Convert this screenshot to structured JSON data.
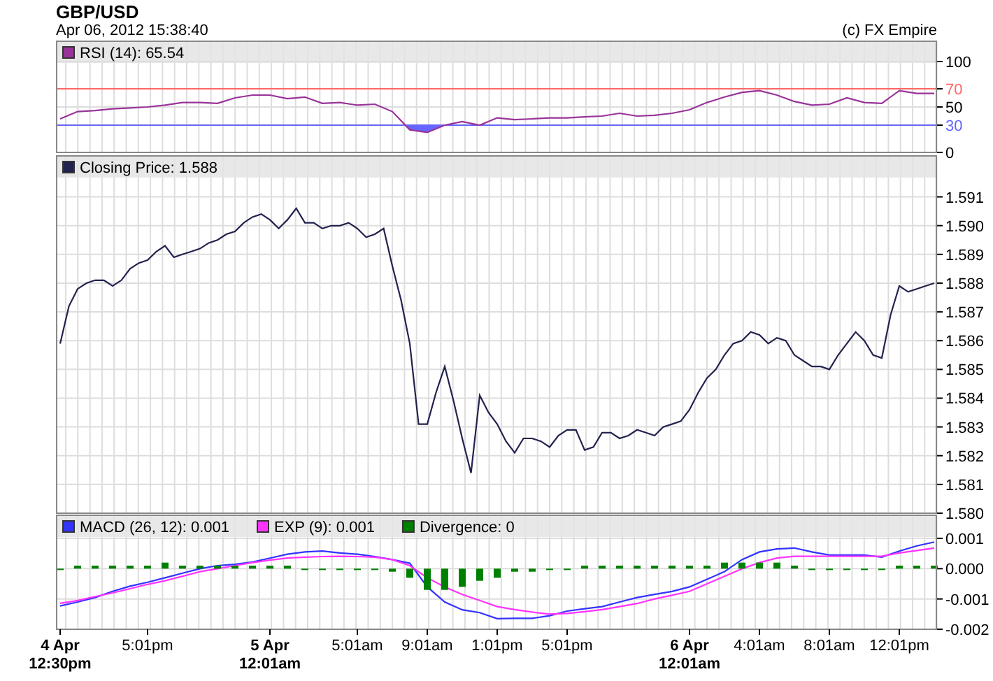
{
  "header": {
    "title": "GBP/USD",
    "timestamp": "Apr 06, 2012 15:38:40",
    "copyright": "(c) FX Empire"
  },
  "panels": [
    {
      "kind": "rsi",
      "chart_data": {
        "type": "line",
        "grid": true,
        "legend": true,
        "ylim": [
          0,
          100
        ],
        "yticks": [
          0,
          30,
          50,
          70,
          100
        ],
        "categories": [
          null,
          null,
          null,
          null,
          null,
          null,
          null,
          null,
          null,
          null,
          null,
          null,
          null,
          null,
          null,
          null,
          null,
          null,
          null,
          null,
          null,
          null,
          null,
          null,
          null,
          null,
          null,
          null,
          null,
          null,
          null,
          null,
          null,
          null,
          null,
          null,
          null,
          null,
          null,
          null,
          null,
          null,
          null,
          null,
          null,
          null,
          null,
          null,
          null,
          null,
          null
        ],
        "series": [
          {
            "name": "RSI (14): 65.54",
            "color": "#993399",
            "values": [
              37,
              45,
              46,
              48,
              49,
              50,
              52,
              55,
              55,
              54,
              60,
              63,
              63,
              59,
              61,
              54,
              55,
              52,
              53,
              45,
              25,
              22,
              30,
              34,
              30,
              38,
              36,
              37,
              38,
              38,
              39,
              40,
              43,
              40,
              41,
              43,
              47,
              55,
              61,
              66,
              68,
              63,
              56,
              52,
              53,
              60,
              55,
              54,
              68,
              65,
              65
            ]
          }
        ],
        "ref_lines": [
          {
            "axis": "y",
            "value": 70,
            "color": "#ff6666"
          },
          {
            "axis": "y",
            "value": 30,
            "color": "#6666ff"
          }
        ]
      }
    },
    {
      "kind": "price",
      "chart_data": {
        "type": "line",
        "grid": true,
        "legend": true,
        "ylim": [
          1.58,
          1.5924
        ],
        "yticks": [
          {
            "value": 1.58,
            "label": "1.580"
          },
          {
            "value": 1.581,
            "label": "1.581"
          },
          {
            "value": 1.582,
            "label": "1.582"
          },
          {
            "value": 1.583,
            "label": "1.583"
          },
          {
            "value": 1.584,
            "label": "1.584"
          },
          {
            "value": 1.585,
            "label": "1.585"
          },
          {
            "value": 1.586,
            "label": "1.586"
          },
          {
            "value": 1.587,
            "label": "1.587"
          },
          {
            "value": 1.588,
            "label": "1.588"
          },
          {
            "value": 1.589,
            "label": "1.589"
          },
          {
            "value": 1.59,
            "label": "1.590"
          },
          {
            "value": 1.591,
            "label": "1.591"
          }
        ],
        "categories": [
          null,
          null,
          null,
          null,
          null,
          null,
          null,
          null,
          null,
          null,
          null,
          null,
          null,
          null,
          null,
          null,
          null,
          null,
          null,
          null,
          null,
          null,
          null,
          null,
          null,
          null,
          null,
          null,
          null,
          null,
          null,
          null,
          null,
          null,
          null,
          null,
          null,
          null,
          null,
          null,
          null,
          null,
          null,
          null,
          null,
          null,
          null,
          null,
          null,
          null,
          null,
          null,
          null,
          null,
          null,
          null,
          null,
          null,
          null,
          null,
          null,
          null,
          null,
          null,
          null,
          null,
          null,
          null,
          null,
          null,
          null,
          null,
          null,
          null,
          null,
          null,
          null,
          null,
          null,
          null,
          null,
          null,
          null,
          null,
          null,
          null,
          null,
          null,
          null,
          null,
          null,
          null,
          null,
          null,
          null,
          null,
          null,
          null,
          null,
          null,
          null
        ],
        "series": [
          {
            "name": "Closing Price: 1.588",
            "color": "#22224f",
            "values": [
              1.5859,
              1.5872,
              1.5878,
              1.588,
              1.5881,
              1.5881,
              1.5879,
              1.5881,
              1.5885,
              1.5887,
              1.5888,
              1.5891,
              1.5893,
              1.5889,
              1.589,
              1.5891,
              1.5892,
              1.5894,
              1.5895,
              1.5897,
              1.5898,
              1.5901,
              1.5903,
              1.5904,
              1.5902,
              1.5899,
              1.5902,
              1.5906,
              1.5901,
              1.5901,
              1.5899,
              1.59,
              1.59,
              1.5901,
              1.5899,
              1.5896,
              1.5897,
              1.5899,
              1.5886,
              1.5874,
              1.5859,
              1.5831,
              1.5831,
              1.5842,
              1.5851,
              1.5839,
              1.5826,
              1.5814,
              1.5841,
              1.5835,
              1.5831,
              1.5825,
              1.5821,
              1.5826,
              1.5826,
              1.5825,
              1.5823,
              1.5827,
              1.5829,
              1.5829,
              1.5822,
              1.5823,
              1.5828,
              1.5828,
              1.5826,
              1.5827,
              1.5829,
              1.5828,
              1.5827,
              1.583,
              1.5831,
              1.5832,
              1.5836,
              1.5842,
              1.5847,
              1.585,
              1.5855,
              1.5859,
              1.586,
              1.5863,
              1.5862,
              1.5859,
              1.5861,
              1.586,
              1.5855,
              1.5853,
              1.5851,
              1.5851,
              1.585,
              1.5855,
              1.5859,
              1.5863,
              1.586,
              1.5855,
              1.5854,
              1.5869,
              1.5879,
              1.5877,
              1.5878,
              1.5879,
              1.588
            ]
          }
        ]
      }
    },
    {
      "kind": "macd",
      "chart_data": {
        "type": "line",
        "grid": true,
        "legend": true,
        "ylim": [
          -0.002,
          0.001
        ],
        "yticks": [
          {
            "value": -0.002,
            "label": "-0.002"
          },
          {
            "value": -0.001,
            "label": "-0.001"
          },
          {
            "value": 0,
            "label": "0.000"
          },
          {
            "value": 0.001,
            "label": "0.001"
          }
        ],
        "categories": [
          "4 Apr\n12:30pm",
          null,
          null,
          null,
          null,
          "5:01pm",
          null,
          null,
          null,
          null,
          null,
          null,
          "5 Apr\n12:01am",
          null,
          null,
          null,
          null,
          "5:01am",
          null,
          null,
          null,
          "9:01am",
          null,
          null,
          null,
          "1:01pm",
          null,
          null,
          null,
          "5:01pm",
          null,
          null,
          null,
          null,
          null,
          null,
          "6 Apr\n12:01am",
          null,
          null,
          null,
          "4:01am",
          null,
          null,
          null,
          "8:01am",
          null,
          null,
          null,
          "12:01pm",
          null,
          null
        ],
        "series": [
          {
            "name": "MACD (26, 12): 0.001",
            "color": "#3333ff",
            "type": "line",
            "values": [
              -0.00123,
              -0.0011,
              -0.00095,
              -0.00075,
              -0.00058,
              -0.00045,
              -0.0003,
              -0.00015,
              0,
              0.0001,
              0.00014,
              0.00022,
              0.00035,
              0.00048,
              0.00055,
              0.00058,
              0.00052,
              0.00048,
              0.0004,
              0.0003,
              0.00018,
              -0.0006,
              -0.0011,
              -0.00136,
              -0.00145,
              -0.00165,
              -0.00164,
              -0.00164,
              -0.00155,
              -0.0014,
              -0.00132,
              -0.00125,
              -0.0011,
              -0.00095,
              -0.00085,
              -0.00075,
              -0.0006,
              -0.00035,
              -0.0001,
              0.0003,
              0.00055,
              0.00065,
              0.00068,
              0.00055,
              0.00045,
              0.00045,
              0.00045,
              0.00038,
              0.00058,
              0.00075,
              0.00088
            ]
          },
          {
            "name": "EXP (9): 0.001",
            "color": "#ff33ff",
            "type": "line",
            "values": [
              -0.00114,
              -0.00105,
              -0.00092,
              -0.0008,
              -0.00066,
              -0.00052,
              -0.0004,
              -0.00025,
              -0.0001,
              0,
              0.0001,
              0.0002,
              0.00028,
              0.00035,
              0.00038,
              0.0004,
              0.00041,
              0.0004,
              0.00038,
              0.0003,
              0.0001,
              -0.0003,
              -0.0006,
              -0.00085,
              -0.00105,
              -0.00125,
              -0.00135,
              -0.00143,
              -0.0015,
              -0.00148,
              -0.00142,
              -0.00135,
              -0.00125,
              -0.00115,
              -0.001,
              -0.00088,
              -0.00075,
              -0.0005,
              -0.00025,
              0,
              0.0002,
              0.00035,
              0.00041,
              0.00041,
              0.00041,
              0.00041,
              0.00041,
              0.00041,
              0.00052,
              0.0006,
              0.00068
            ]
          },
          {
            "name": "Divergence: 0",
            "color": "#008000",
            "type": "bar",
            "values": [
              0,
              0.0001,
              0.0001,
              0.0001,
              0.0001,
              0.0001,
              0.0002,
              0.0001,
              0.0001,
              0.0001,
              0.0001,
              0.0001,
              0.0001,
              0.0001,
              0,
              0,
              0,
              0,
              0,
              -0.0001,
              -0.0003,
              -0.0007,
              -0.0007,
              -0.0006,
              -0.0004,
              -0.0003,
              -0.0001,
              -0.0001,
              0,
              0,
              0.0001,
              0.0001,
              0.0001,
              0.0001,
              0.0001,
              0.0001,
              0.0001,
              0.0001,
              0.0002,
              0.0002,
              0.0002,
              0.0002,
              0.0001,
              0,
              0,
              0,
              0,
              0,
              0.0001,
              0.0001,
              0.0001
            ]
          }
        ]
      }
    }
  ]
}
